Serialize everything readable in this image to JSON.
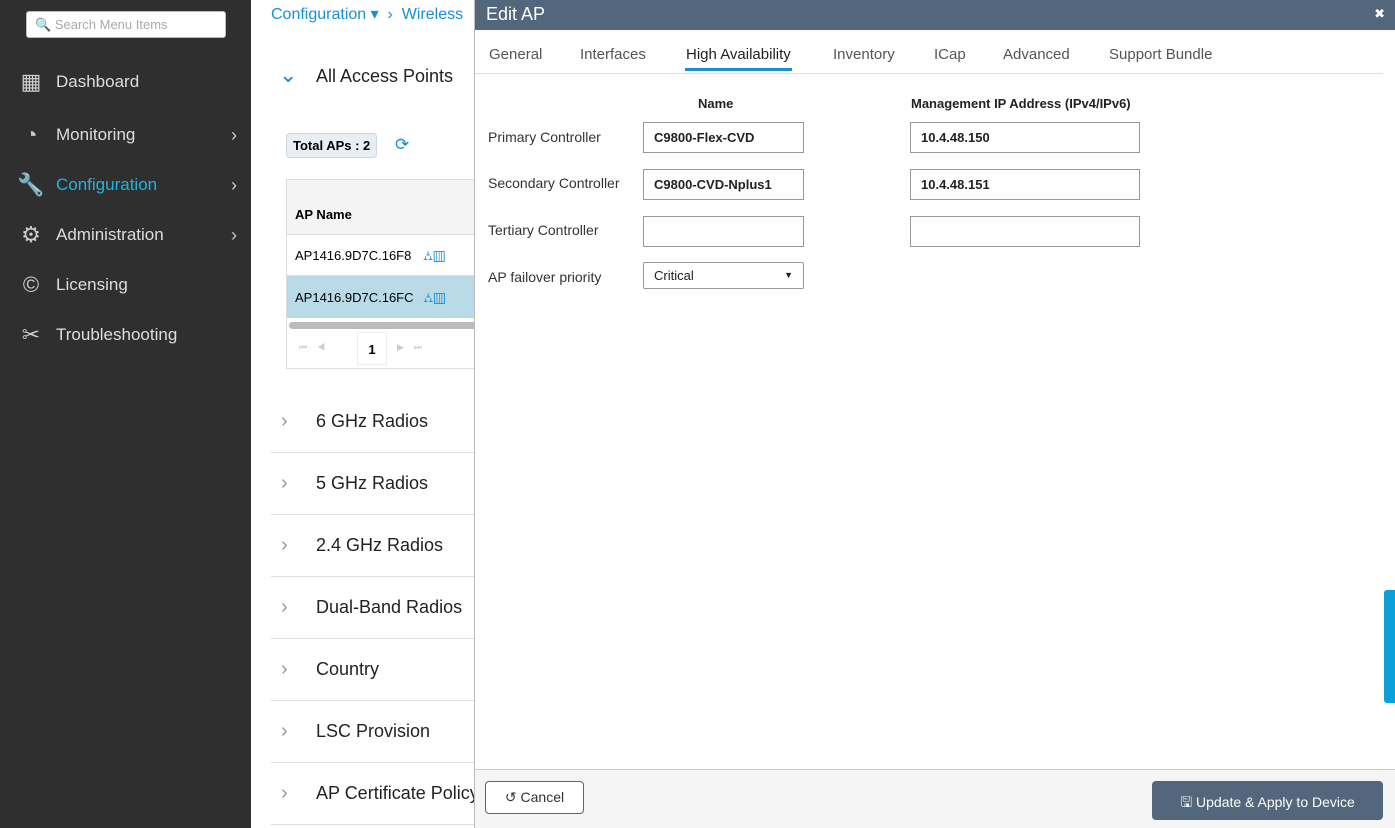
{
  "sidebar": {
    "search_placeholder": "Search Menu Items",
    "items": [
      {
        "label": "Dashboard"
      },
      {
        "label": "Monitoring"
      },
      {
        "label": "Configuration"
      },
      {
        "label": "Administration"
      },
      {
        "label": "Licensing"
      },
      {
        "label": "Troubleshooting"
      }
    ]
  },
  "breadcrumb": {
    "first": "Configuration",
    "second": "Wireless"
  },
  "main": {
    "section_title": "All Access Points",
    "total_aps": "Total APs : 2",
    "column": "AP Name",
    "rows": [
      "AP1416.9D7C.16F8",
      "AP1416.9D7C.16FC"
    ],
    "page": "1",
    "sections": [
      "6 GHz Radios",
      "5 GHz Radios",
      "2.4 GHz Radios",
      "Dual-Band Radios",
      "Country",
      "LSC Provision",
      "AP Certificate Policy"
    ]
  },
  "modal": {
    "title": "Edit AP",
    "tabs": [
      "General",
      "Interfaces",
      "High Availability",
      "Inventory",
      "ICap",
      "Advanced",
      "Support Bundle"
    ],
    "col_name": "Name",
    "col_ip": "Management IP Address (IPv4/IPv6)",
    "rows": [
      {
        "label": "Primary Controller",
        "name": "C9800-Flex-CVD",
        "ip": "10.4.48.150"
      },
      {
        "label": "Secondary Controller",
        "name": "C9800-CVD-Nplus1",
        "ip": "10.4.48.151"
      },
      {
        "label": "Tertiary Controller",
        "name": "",
        "ip": ""
      }
    ],
    "priority_label": "AP failover priority",
    "priority_value": "Critical",
    "cancel": "Cancel",
    "apply": "Update & Apply to Device"
  }
}
